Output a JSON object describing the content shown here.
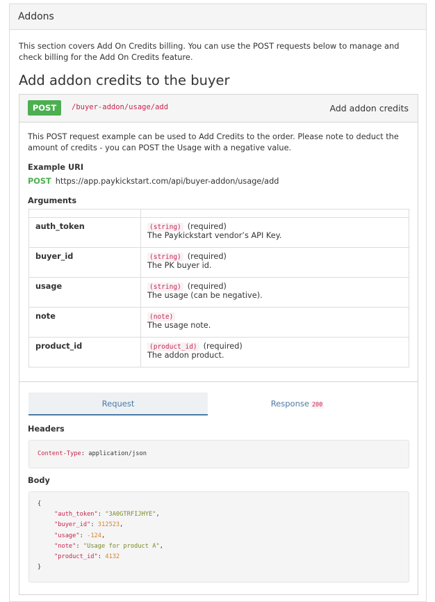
{
  "section": {
    "title": "Addons",
    "intro": "This section covers Add On Credits billing. You can use the POST requests below to manage and check billing for the Add On Credits feature."
  },
  "endpoint": {
    "heading": "Add addon credits to the buyer",
    "method": "POST",
    "path": "/buyer-addon/usage/add",
    "title": "Add addon credits",
    "description": "This POST request example can be used to Add Credits to the order. Please note to deduct the amount of credits - you can POST the Usage with a negative value.",
    "example_uri_label": "Example URI",
    "uri_method": "POST",
    "uri": "https://app.paykickstart.com/api/buyer-addon/usage/add",
    "arguments_label": "Arguments",
    "arguments": [
      {
        "name": "auth_token",
        "type": "(string)",
        "required": "(required)",
        "desc": "The Paykickstart vendor’s API Key."
      },
      {
        "name": "buyer_id",
        "type": "(string)",
        "required": "(required)",
        "desc": "The PK buyer id."
      },
      {
        "name": "usage",
        "type": "(string)",
        "required": "(required)",
        "desc": "The usage (can be negative)."
      },
      {
        "name": "note",
        "type": "(note)",
        "required": "",
        "desc": "The usage note."
      },
      {
        "name": "product_id",
        "type": "(product_id)",
        "required": "(required)",
        "desc": "The addon product."
      }
    ],
    "tabs": {
      "request": "Request",
      "response": "Response",
      "response_code": "200"
    },
    "headers_label": "Headers",
    "header_key": "Content-Type",
    "header_value": "application/json",
    "body_label": "Body",
    "body": {
      "open": "{",
      "close": "}",
      "fields": [
        {
          "key": "\"auth_token\"",
          "value": "\"3A0GTRFIJHYE\"",
          "kind": "s",
          "comma": ","
        },
        {
          "key": "\"buyer_id\"",
          "value": "312523",
          "kind": "n",
          "comma": ","
        },
        {
          "key": "\"usage\"",
          "value": "-124",
          "kind": "n",
          "comma": ","
        },
        {
          "key": "\"note\"",
          "value": "\"Usage for product A\"",
          "kind": "s",
          "comma": ","
        },
        {
          "key": "\"product_id\"",
          "value": "4132",
          "kind": "n",
          "comma": ""
        }
      ]
    }
  }
}
